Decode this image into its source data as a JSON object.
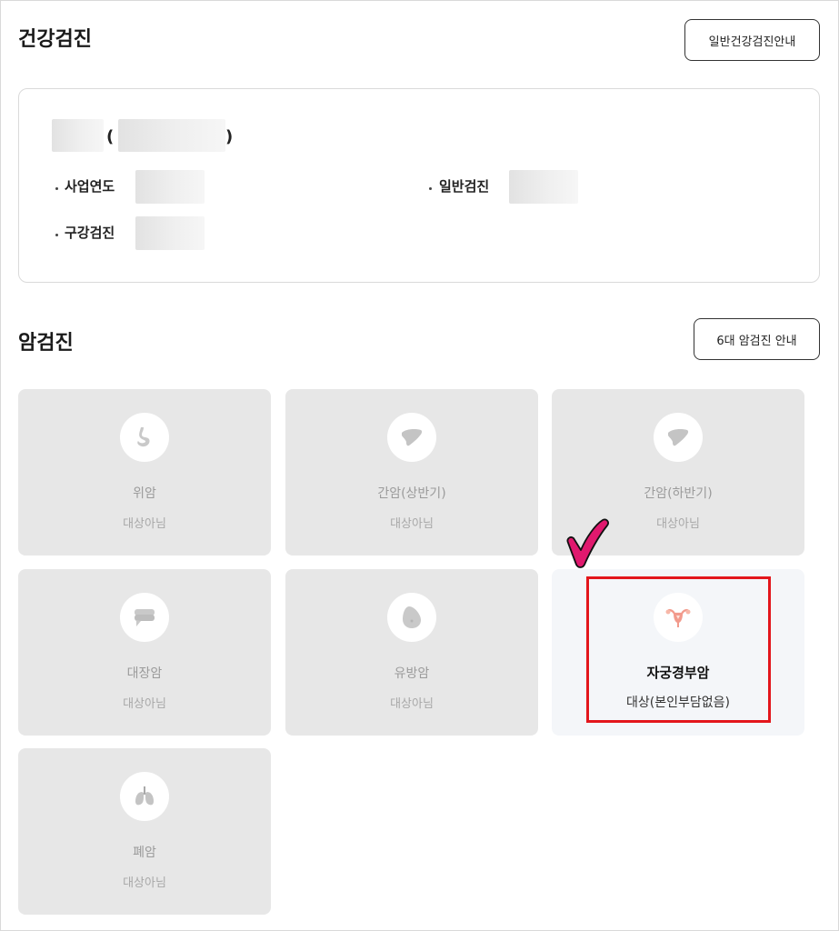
{
  "health_checkup": {
    "title": "건강검진",
    "guide_button": "일반건강검진안내",
    "info": {
      "open_paren": "(",
      "close_paren": ")",
      "fields": [
        {
          "label": "사업연도"
        },
        {
          "label": "일반검진"
        },
        {
          "label": "구강검진"
        }
      ]
    }
  },
  "cancer_checkup": {
    "title": "암검진",
    "guide_button": "6대 암검진 안내",
    "cards": [
      {
        "name": "위암",
        "status": "대상아님",
        "icon": "stomach-icon"
      },
      {
        "name": "간암(상반기)",
        "status": "대상아님",
        "icon": "liver-icon"
      },
      {
        "name": "간암(하반기)",
        "status": "대상아님",
        "icon": "liver-icon"
      },
      {
        "name": "대장암",
        "status": "대상아님",
        "icon": "colon-icon"
      },
      {
        "name": "유방암",
        "status": "대상아님",
        "icon": "breast-icon"
      },
      {
        "name": "자궁경부암",
        "status": "대상(본인부담없음)",
        "icon": "uterus-icon"
      },
      {
        "name": "폐암",
        "status": "대상아님",
        "icon": "lungs-icon"
      }
    ]
  },
  "colors": {
    "highlight": "#e3161c",
    "check_mark": "#e0196e",
    "card_inactive": "#e7e7e7",
    "card_active": "#f4f6f9",
    "uterus_icon": "#f29a8c"
  }
}
